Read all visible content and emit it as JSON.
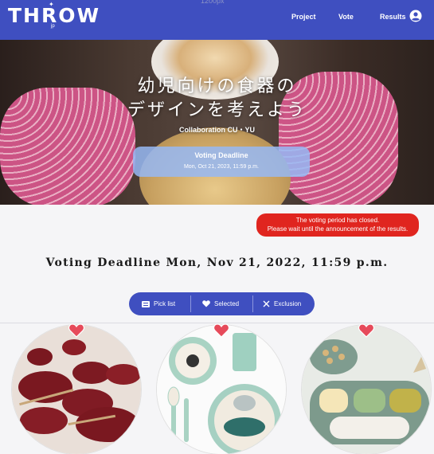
{
  "header": {
    "logo": "THROW",
    "logo_sub": "jp",
    "top_marker": "1200px",
    "nav": [
      "Project",
      "Vote",
      "Results"
    ],
    "user_icon": "user-circle-icon",
    "bg_color": "#3f4fc0"
  },
  "hero": {
    "title_line1": "幼児向けの食器の",
    "title_line2": "デザインを考えよう",
    "subtitle": "Collaboration CU・YU",
    "deadline_label": "Voting Deadline",
    "deadline_value": "Mon, Oct 21, 2023, 11:59 p.m."
  },
  "notice": {
    "line1": "The voting period has closed.",
    "line2": "Please wait until the announcement of the results.",
    "color": "#e0251f"
  },
  "main": {
    "deadline": "Voting Deadline Mon, Nov 21, 2022, 11:59 p.m."
  },
  "filter": {
    "items": [
      {
        "label": "Pick list",
        "icon": "list-icon"
      },
      {
        "label": "Selected",
        "icon": "heart-icon"
      },
      {
        "label": "Exclusion",
        "icon": "close-icon"
      }
    ]
  },
  "products": [
    {
      "name": "red-lacquer-dishware",
      "liked": true
    },
    {
      "name": "animal-print-dishware",
      "liked": true
    },
    {
      "name": "green-silicone-dishware",
      "liked": true
    }
  ]
}
